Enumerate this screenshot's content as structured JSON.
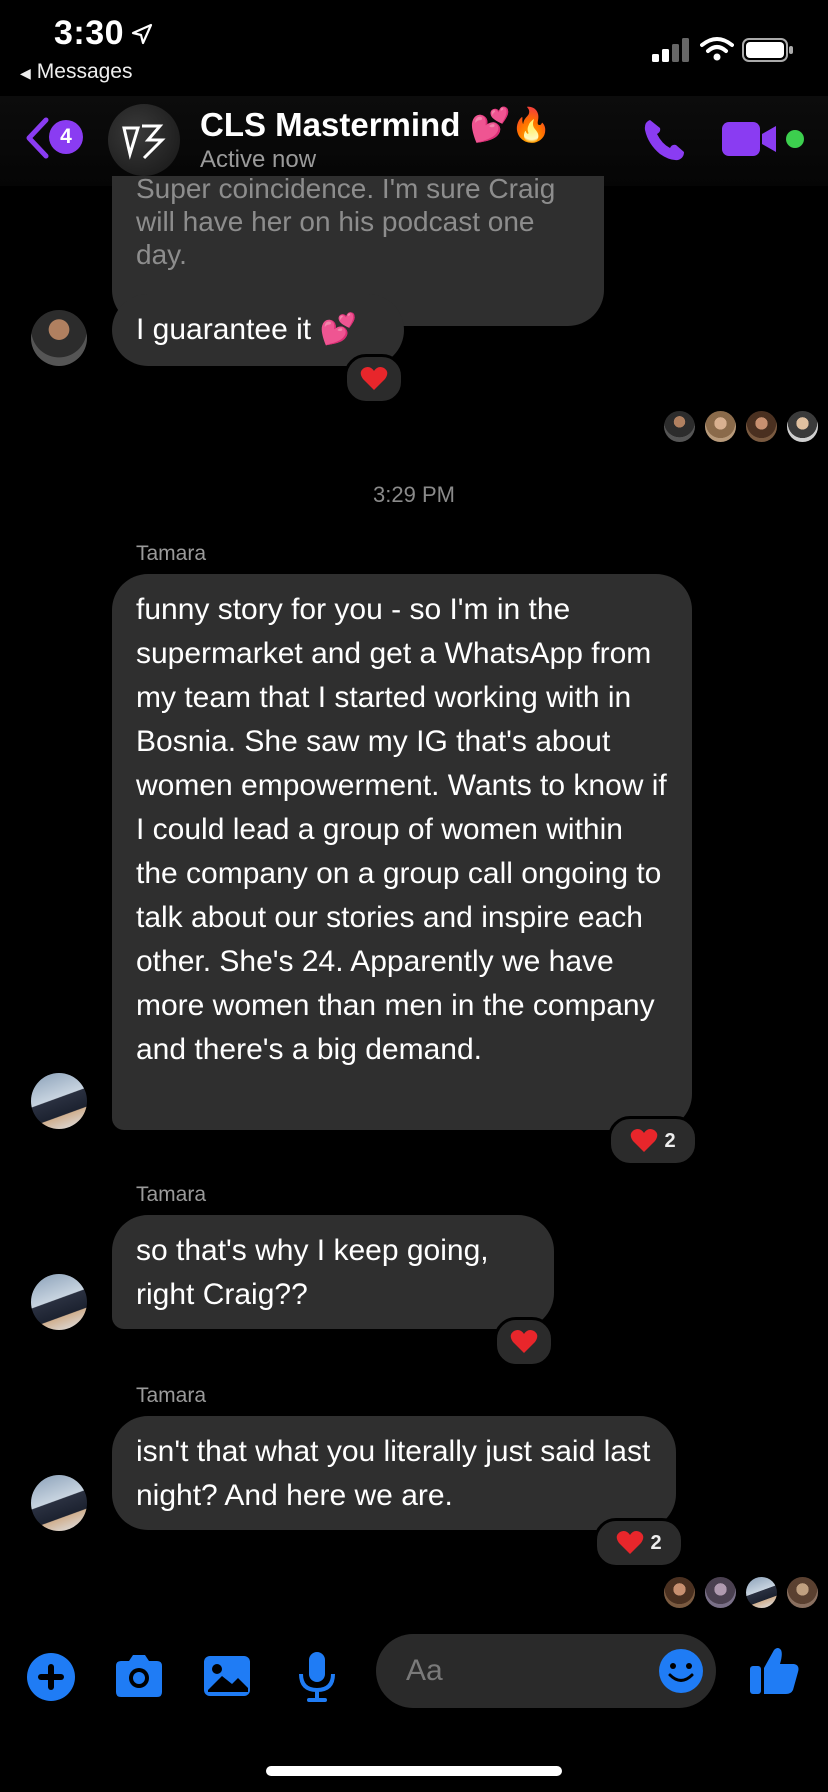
{
  "status_bar": {
    "time": "3:30",
    "back_app": "Messages"
  },
  "header": {
    "unread_count": "4",
    "title": "CLS Mastermind 💕🔥",
    "status": "Active now"
  },
  "messages": {
    "partial_text": "Super coincidence. I'm sure Craig will have her on his podcast one day.",
    "guarantee_text": "I guarantee it 💕",
    "timestamp": "3:29 PM",
    "tamara_1": {
      "sender": "Tamara",
      "text": "funny story for you - so I'm in the supermarket and get a WhatsApp from my team that I started working with in Bosnia. She saw my IG that's about women empowerment. Wants to know if I could lead a group of women within the company on a group call ongoing to talk about our stories and inspire each other. She's 24. Apparently we have more women than men in the company and there's a big demand.",
      "reaction_count": "2"
    },
    "tamara_2": {
      "sender": "Tamara",
      "text": "so that's why I keep going, right Craig??"
    },
    "tamara_3": {
      "sender": "Tamara",
      "text": "isn't that what you literally just said last night? And here we are.",
      "reaction_count": "2"
    }
  },
  "composer": {
    "placeholder": "Aa"
  },
  "colors": {
    "accent": "#8a3cf2",
    "tool_blue": "#1f7cf5",
    "bubble": "#2f2f2f",
    "online": "#3ccf4e"
  },
  "icons": [
    "location-arrow-icon",
    "signal-icon",
    "wifi-icon",
    "battery-icon",
    "back-chevron-icon",
    "phone-icon",
    "video-icon",
    "plus-icon",
    "camera-icon",
    "photo-icon",
    "mic-icon",
    "emoji-icon",
    "thumbs-up-icon",
    "heart-icon"
  ]
}
